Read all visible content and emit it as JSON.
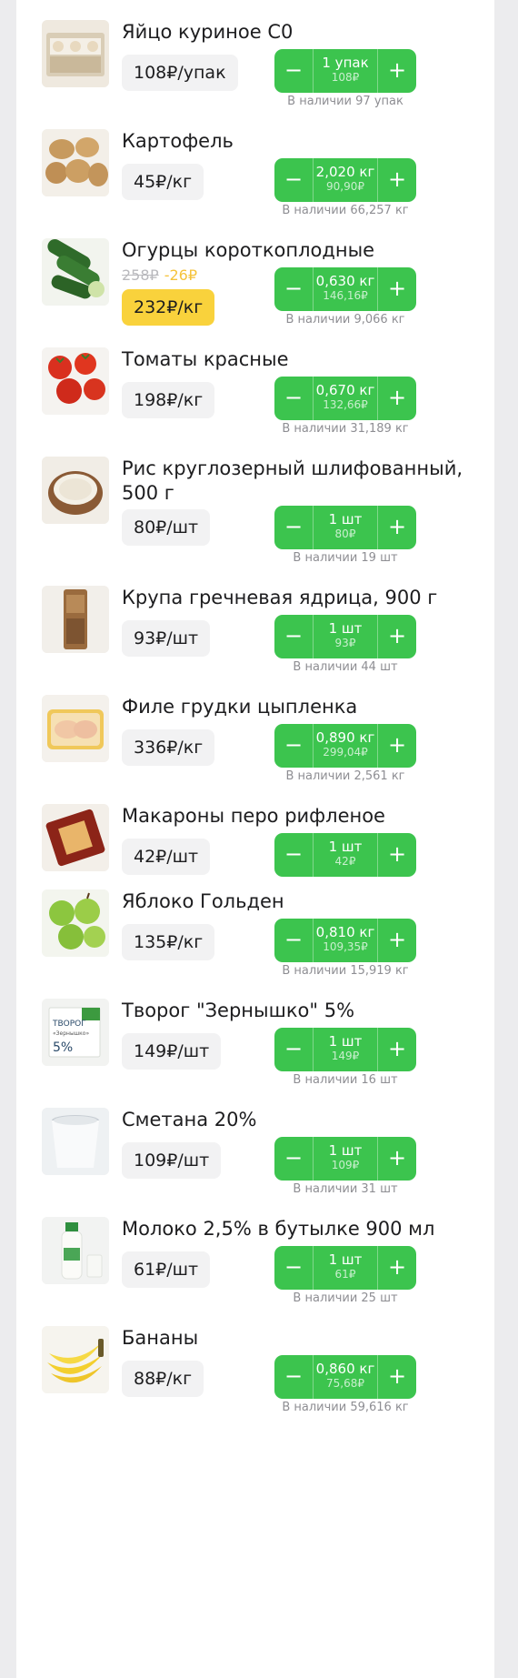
{
  "items": [
    {
      "name": "Яйцо куриное С0",
      "price": "108₽/упак",
      "qty": "1 упак",
      "total": "108₽",
      "stock": "В наличии 97 упак",
      "minus": "−",
      "plus": "+",
      "icon": "eggs-carton-icon"
    },
    {
      "name": "Картофель",
      "price": "45₽/кг",
      "qty": "2,020 кг",
      "total": "90,90₽",
      "stock": "В наличии 66,257 кг",
      "minus": "−",
      "plus": "+",
      "icon": "potato-icon"
    },
    {
      "name": "Огурцы короткоплодные",
      "old_price": "258₽",
      "discount": "-26₽",
      "price": "232₽/кг",
      "qty": "0,630 кг",
      "total": "146,16₽",
      "stock": "В наличии 9,066 кг",
      "minus": "−",
      "plus": "+",
      "icon": "cucumber-icon"
    },
    {
      "name": "Томаты красные",
      "price": "198₽/кг",
      "qty": "0,670 кг",
      "total": "132,66₽",
      "stock": "В наличии 31,189 кг",
      "minus": "−",
      "plus": "+",
      "icon": "tomato-icon"
    },
    {
      "name": "Рис круглозерный шлифованный, 500 г",
      "price": "80₽/шт",
      "qty": "1 шт",
      "total": "80₽",
      "stock": "В наличии 19 шт",
      "minus": "−",
      "plus": "+",
      "icon": "rice-bowl-icon"
    },
    {
      "name": "Крупа гречневая ядрица, 900 г",
      "price": "93₽/шт",
      "qty": "1 шт",
      "total": "93₽",
      "stock": "В наличии 44 шт",
      "minus": "−",
      "plus": "+",
      "icon": "buckwheat-pack-icon"
    },
    {
      "name": "Филе грудки цыпленка",
      "price": "336₽/кг",
      "qty": "0,890 кг",
      "total": "299,04₽",
      "stock": "В наличии 2,561 кг",
      "minus": "−",
      "plus": "+",
      "icon": "chicken-fillet-icon"
    },
    {
      "name": "Макароны перо рифленое",
      "price": "42₽/шт",
      "qty": "1 шт",
      "total": "42₽",
      "stock": "",
      "minus": "−",
      "plus": "+",
      "icon": "pasta-pack-icon"
    },
    {
      "name": "Яблоко Гольден",
      "price": "135₽/кг",
      "qty": "0,810 кг",
      "total": "109,35₽",
      "stock": "В наличии 15,919 кг",
      "minus": "−",
      "plus": "+",
      "icon": "apple-icon"
    },
    {
      "name": "Творог \"Зернышко\" 5%",
      "price": "149₽/шт",
      "qty": "1 шт",
      "total": "149₽",
      "stock": "В наличии 16 шт",
      "minus": "−",
      "plus": "+",
      "icon": "cottage-cheese-icon",
      "pack_label": "ТВОРОГ",
      "pack_sub": "«Зернышко»",
      "pack_pct": "5%"
    },
    {
      "name": "Сметана 20%",
      "price": "109₽/шт",
      "qty": "1 шт",
      "total": "109₽",
      "stock": "В наличии 31 шт",
      "minus": "−",
      "plus": "+",
      "icon": "sour-cream-cup-icon"
    },
    {
      "name": "Молоко 2,5% в бутылке 900 мл",
      "price": "61₽/шт",
      "qty": "1 шт",
      "total": "61₽",
      "stock": "В наличии 25 шт",
      "minus": "−",
      "plus": "+",
      "icon": "milk-bottle-icon"
    },
    {
      "name": "Бананы",
      "price": "88₽/кг",
      "qty": "0,860 кг",
      "total": "75,68₽",
      "stock": "В наличии 59,616 кг",
      "minus": "−",
      "plus": "+",
      "icon": "banana-icon"
    }
  ],
  "colors": {
    "accent": "#3cc44e",
    "sale": "#f9d23c",
    "discount": "#f5c33b"
  }
}
